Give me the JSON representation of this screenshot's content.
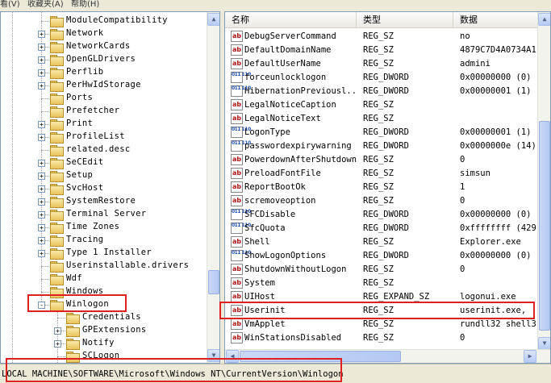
{
  "menu": [
    "看(V)",
    "收藏夹(A)",
    "帮助(H)"
  ],
  "tree": {
    "items": [
      {
        "label": "ModuleCompatibility",
        "expander": ""
      },
      {
        "label": "Network",
        "expander": "+"
      },
      {
        "label": "NetworkCards",
        "expander": "+"
      },
      {
        "label": "OpenGLDrivers",
        "expander": "+"
      },
      {
        "label": "Perflib",
        "expander": "+"
      },
      {
        "label": "PerHwIdStorage",
        "expander": "+"
      },
      {
        "label": "Ports",
        "expander": ""
      },
      {
        "label": "Prefetcher",
        "expander": ""
      },
      {
        "label": "Print",
        "expander": "+"
      },
      {
        "label": "ProfileList",
        "expander": "+"
      },
      {
        "label": "related.desc",
        "expander": ""
      },
      {
        "label": "SeCEdit",
        "expander": "+"
      },
      {
        "label": "Setup",
        "expander": "+"
      },
      {
        "label": "SvcHost",
        "expander": "+"
      },
      {
        "label": "SystemRestore",
        "expander": "+"
      },
      {
        "label": "Terminal Server",
        "expander": "+"
      },
      {
        "label": "Time Zones",
        "expander": "+"
      },
      {
        "label": "Tracing",
        "expander": "+"
      },
      {
        "label": "Type 1 Installer",
        "expander": "+"
      },
      {
        "label": "Userinstallable.drivers",
        "expander": ""
      },
      {
        "label": "Wdf",
        "expander": ""
      },
      {
        "label": "Windows",
        "expander": ""
      },
      {
        "label": "Winlogon",
        "expander": "-"
      },
      {
        "label": "Credentials",
        "expander": "",
        "child": true
      },
      {
        "label": "GPExtensions",
        "expander": "+",
        "child": true
      },
      {
        "label": "Notify",
        "expander": "+",
        "child": true
      },
      {
        "label": "SCLogon",
        "expander": "",
        "child": true
      }
    ]
  },
  "list": {
    "columns": [
      "名称",
      "类型",
      "数据"
    ],
    "rows": [
      {
        "name": "DebugServerCommand",
        "type": "REG_SZ",
        "data": "no",
        "icon": "ab"
      },
      {
        "name": "DefaultDomainName",
        "type": "REG_SZ",
        "data": "4879C7D4A0734A1",
        "icon": "ab"
      },
      {
        "name": "DefaultUserName",
        "type": "REG_SZ",
        "data": "admini",
        "icon": "ab"
      },
      {
        "name": "forceunlocklogon",
        "type": "REG_DWORD",
        "data": "0x00000000 (0)",
        "icon": "bin"
      },
      {
        "name": "HibernationPreviousl...",
        "type": "REG_DWORD",
        "data": "0x00000001 (1)",
        "icon": "bin"
      },
      {
        "name": "LegalNoticeCaption",
        "type": "REG_SZ",
        "data": "",
        "icon": "ab"
      },
      {
        "name": "LegalNoticeText",
        "type": "REG_SZ",
        "data": "",
        "icon": "ab"
      },
      {
        "name": "LogonType",
        "type": "REG_DWORD",
        "data": "0x00000001 (1)",
        "icon": "bin"
      },
      {
        "name": "passwordexpirywarning",
        "type": "REG_DWORD",
        "data": "0x0000000e (14)",
        "icon": "bin"
      },
      {
        "name": "PowerdownAfterShutdown",
        "type": "REG_SZ",
        "data": "0",
        "icon": "ab"
      },
      {
        "name": "PreloadFontFile",
        "type": "REG_SZ",
        "data": "simsun",
        "icon": "ab"
      },
      {
        "name": "ReportBootOk",
        "type": "REG_SZ",
        "data": "1",
        "icon": "ab"
      },
      {
        "name": "scremoveoption",
        "type": "REG_SZ",
        "data": "0",
        "icon": "ab"
      },
      {
        "name": "SFCDisable",
        "type": "REG_DWORD",
        "data": "0x00000000 (0)",
        "icon": "bin"
      },
      {
        "name": "SfcQuota",
        "type": "REG_DWORD",
        "data": "0xffffffff (429",
        "icon": "bin"
      },
      {
        "name": "Shell",
        "type": "REG_SZ",
        "data": "Explorer.exe",
        "icon": "ab"
      },
      {
        "name": "ShowLogonOptions",
        "type": "REG_DWORD",
        "data": "0x00000000 (0)",
        "icon": "bin"
      },
      {
        "name": "ShutdownWithoutLogon",
        "type": "REG_SZ",
        "data": "0",
        "icon": "ab"
      },
      {
        "name": "System",
        "type": "REG_SZ",
        "data": "",
        "icon": "ab"
      },
      {
        "name": "UIHost",
        "type": "REG_EXPAND_SZ",
        "data": "logonui.exe",
        "icon": "ab"
      },
      {
        "name": "Userinit",
        "type": "REG_SZ",
        "data": "userinit.exe,",
        "icon": "ab"
      },
      {
        "name": "VmApplet",
        "type": "REG_SZ",
        "data": "rundll32 shell3",
        "icon": "ab"
      },
      {
        "name": "WinStationsDisabled",
        "type": "REG_SZ",
        "data": "0",
        "icon": "ab"
      }
    ]
  },
  "status": {
    "path": "LOCAL MACHINE\\SOFTWARE\\Microsoft\\Windows NT\\CurrentVersion\\Winlogon"
  }
}
